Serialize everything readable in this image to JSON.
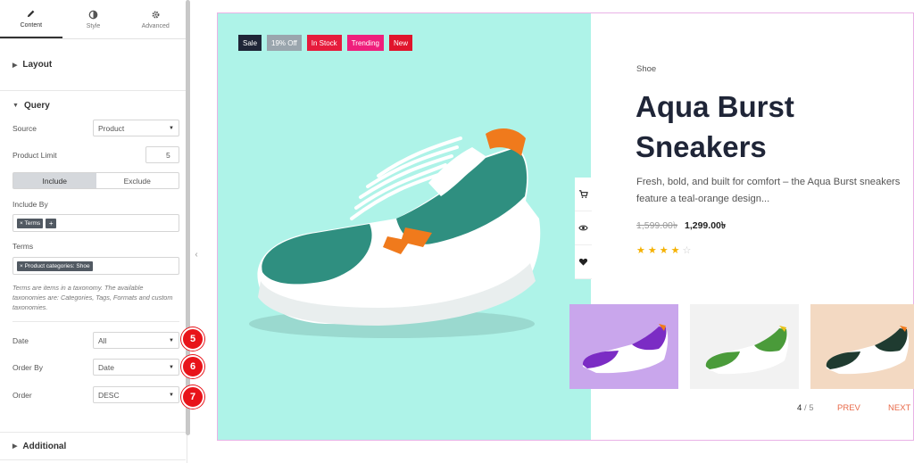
{
  "panel": {
    "tabs": [
      {
        "label": "Content",
        "icon": "pencil-icon"
      },
      {
        "label": "Style",
        "icon": "contrast-icon"
      },
      {
        "label": "Advanced",
        "icon": "gear-icon"
      }
    ],
    "layout_label": "Layout",
    "query_label": "Query",
    "source_label": "Source",
    "source_value": "Product",
    "limit_label": "Product Limit",
    "limit_value": "5",
    "include_label": "Include",
    "exclude_label": "Exclude",
    "include_by_label": "Include By",
    "include_by_chip": "× Terms",
    "include_by_add": "+",
    "terms_label": "Terms",
    "terms_chip": "× Product categories: Shoe",
    "terms_help": "Terms are items in a taxonomy. The available taxonomies are: Categories, Tags, Formats and custom taxonomies.",
    "date_label": "Date",
    "date_value": "All",
    "order_by_label": "Order By",
    "order_by_value": "Date",
    "order_label": "Order",
    "order_value": "DESC",
    "additional_label": "Additional",
    "markers": [
      "5",
      "6",
      "7"
    ]
  },
  "product": {
    "badges": [
      {
        "label": "Sale",
        "color": "#1f2537"
      },
      {
        "label": "19% Off",
        "color": "#9aa5ad"
      },
      {
        "label": "In Stock",
        "color": "#e61b3c"
      },
      {
        "label": "Trending",
        "color": "#ef1f7c"
      },
      {
        "label": "New",
        "color": "#e0142c"
      }
    ],
    "category": "Shoe",
    "title": "Aqua Burst Sneakers",
    "description": "Fresh, bold, and built for comfort – the Aqua Burst sneakers feature a teal-orange design...",
    "price_old": "1,599.00৳",
    "price_new": "1,299.00৳",
    "rating": 4,
    "rating_max": 5,
    "actions": [
      "cart-icon",
      "eye-icon",
      "heart-icon"
    ],
    "thumb_colors": [
      "#c9a6ec",
      "#f2f2f2",
      "#f3d9c2"
    ],
    "pager": {
      "current": "4",
      "separator": "/",
      "total": "5",
      "prev": "PREV",
      "next": "NEXT"
    }
  }
}
